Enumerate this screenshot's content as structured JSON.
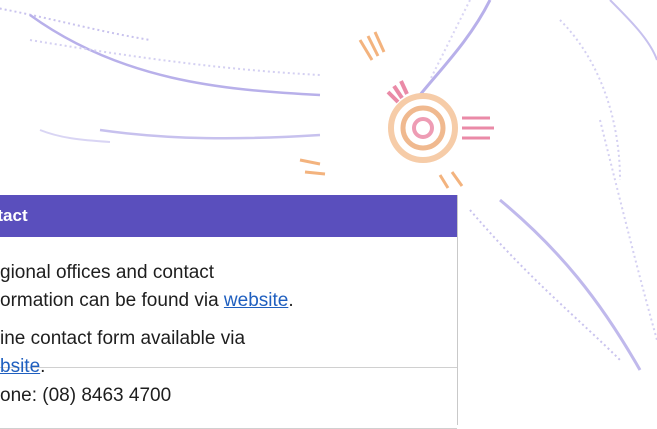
{
  "contact": {
    "header": "ntact",
    "regional_line1": "gional offices and contact",
    "regional_line2_prefix": "ormation can be found via ",
    "regional_link": "website",
    "regional_suffix": ".",
    "online_line1": "ine contact form available via",
    "online_link": "bsite",
    "online_suffix": ".",
    "phone_text": "one: (08) 8463 4700"
  },
  "colors": {
    "header_bg": "#5a4fbd",
    "link": "#1f5fbf",
    "accent_orange": "#f3b37e",
    "accent_pink": "#ea8aa7",
    "accent_purple": "#b8b0ea"
  }
}
